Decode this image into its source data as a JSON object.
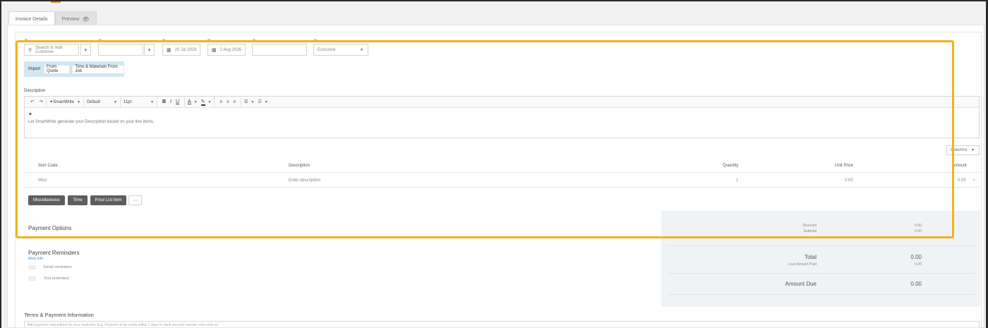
{
  "tabs": [
    {
      "label": "Invoice Details"
    },
    {
      "label": "Preview"
    }
  ],
  "header_fields": {
    "customer_placeholder": "Search or Add Customer",
    "issue_date": "20 Jul 2026",
    "due_date": "2 Aug 2026",
    "tax_mode": "Exclusive"
  },
  "import_bar": {
    "label": "Import",
    "buttons": [
      "From Quote",
      "Time & Materials From Job"
    ]
  },
  "description": {
    "label": "Description",
    "toolbar": {
      "smartwrite": "SmartWrite",
      "font": "Default",
      "size": "11pt"
    },
    "hint": "Let SmartWrite generate your Description based on your line items."
  },
  "columns_button": "Columns",
  "table": {
    "headers": [
      "Item Code",
      "Description",
      "Quantity",
      "Unit Price",
      "Amount"
    ],
    "rows": [
      {
        "item_code": "Misc",
        "description": "Enter description",
        "quantity": "1",
        "unit_price": "0.00",
        "amount": "0.00"
      }
    ]
  },
  "add_buttons": [
    "Miscellaneous",
    "Time",
    "Price List Item"
  ],
  "more_button": "···",
  "payment_options": {
    "heading": "Payment Options"
  },
  "payment_reminders": {
    "heading": "Payment Reminders",
    "more_info": "More info",
    "toggles": [
      "Email reminders",
      "Text reminders"
    ]
  },
  "summary": {
    "discount_label": "Discount",
    "discount": "0.00",
    "subtotal_label": "Subtotal",
    "subtotal": "0.00",
    "total_label": "Total",
    "total": "0.00",
    "less_paid_label": "Less Amount Paid",
    "less_paid": "0.00",
    "amount_due_label": "Amount Due",
    "amount_due": "0.00"
  },
  "terms": {
    "heading": "Terms & Payment Information",
    "placeholder": "Add payment instructions for your customer. E.g. Payment to be made within 7 days to bank account number xxxx xxxx xx"
  },
  "colors": {
    "highlight": "#f2b319",
    "import_bg": "#d2e7f1",
    "dark_button": "#5e5e5e",
    "link": "#3a8bd4"
  }
}
